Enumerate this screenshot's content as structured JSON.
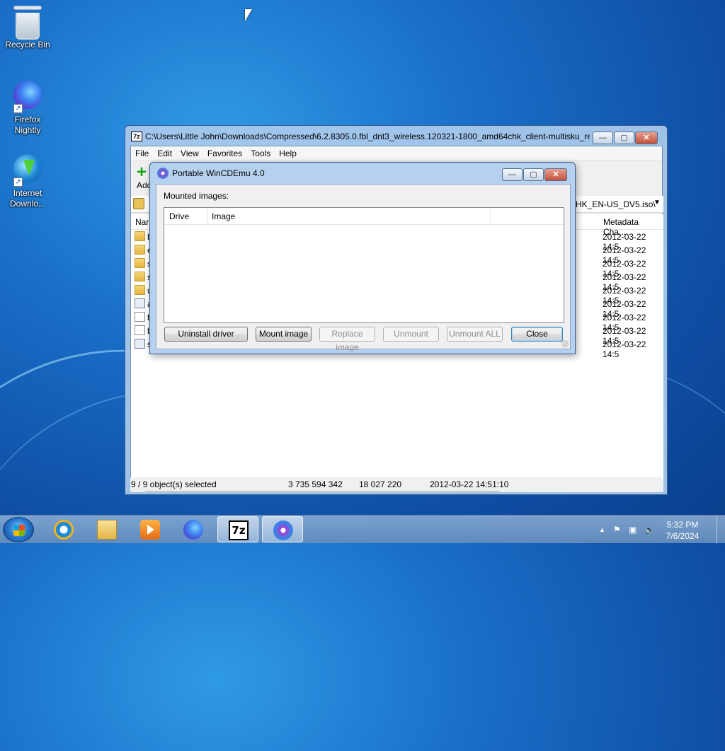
{
  "desktop": {
    "icons": [
      {
        "label": "Recycle Bin",
        "icon": "recycle-bin-icon"
      },
      {
        "label": "Firefox Nightly",
        "icon": "firefox-nightly-icon"
      },
      {
        "label": "Internet Downlo...",
        "icon": "internet-download-manager-icon"
      }
    ]
  },
  "sevenzip": {
    "title": "C:\\Users\\Little John\\Downloads\\Compressed\\6.2.8305.0.fbl_dnt3_wireless.120321-1800_amd64chk_client-multisku_ret...",
    "menu": [
      "File",
      "Edit",
      "View",
      "Favorites",
      "Tools",
      "Help"
    ],
    "toolbar": {
      "add_label": "Add"
    },
    "address_tail": "HK_EN-US_DV5.iso\\",
    "columns": {
      "name": "Nar",
      "metadata": "Metadata Cha..."
    },
    "rows": [
      {
        "type": "folder",
        "name": "b",
        "date": "2012-03-22 14:5"
      },
      {
        "type": "folder",
        "name": "e",
        "date": "2012-03-22 14:5"
      },
      {
        "type": "folder",
        "name": "s",
        "date": "2012-03-22 14:5"
      },
      {
        "type": "folder",
        "name": "s",
        "date": "2012-03-22 14:5"
      },
      {
        "type": "folder",
        "name": "u",
        "date": "2012-03-22 14:5"
      },
      {
        "type": "cfg",
        "name": "a",
        "date": "2012-03-22 14:5"
      },
      {
        "type": "file",
        "name": "b",
        "date": "2012-03-22 14:5"
      },
      {
        "type": "file",
        "name": "b",
        "date": "2012-03-22 14:5"
      },
      {
        "type": "cfg",
        "name": "s",
        "date": "2012-03-22 14:5"
      }
    ],
    "status": {
      "selection": "9 / 9 object(s) selected",
      "size": "3 735 594 342",
      "packed": "18 027 220",
      "modified": "2012-03-22 14:51:10"
    }
  },
  "wincdemu": {
    "title": "Portable WinCDEmu 4.0",
    "mounted_label": "Mounted images:",
    "columns": {
      "drive": "Drive",
      "image": "Image"
    },
    "buttons": {
      "uninstall": "Uninstall driver",
      "mount": "Mount image",
      "replace": "Replace image",
      "unmount": "Unmount",
      "unmount_all": "Unmount ALL",
      "close": "Close"
    }
  },
  "taskbar": {
    "apps": [
      "internet-explorer-icon",
      "windows-explorer-icon",
      "media-player-icon",
      "firefox-icon",
      "7zip-icon",
      "wincdemu-icon"
    ],
    "clock": {
      "time": "5:32 PM",
      "date": "7/6/2024"
    }
  }
}
